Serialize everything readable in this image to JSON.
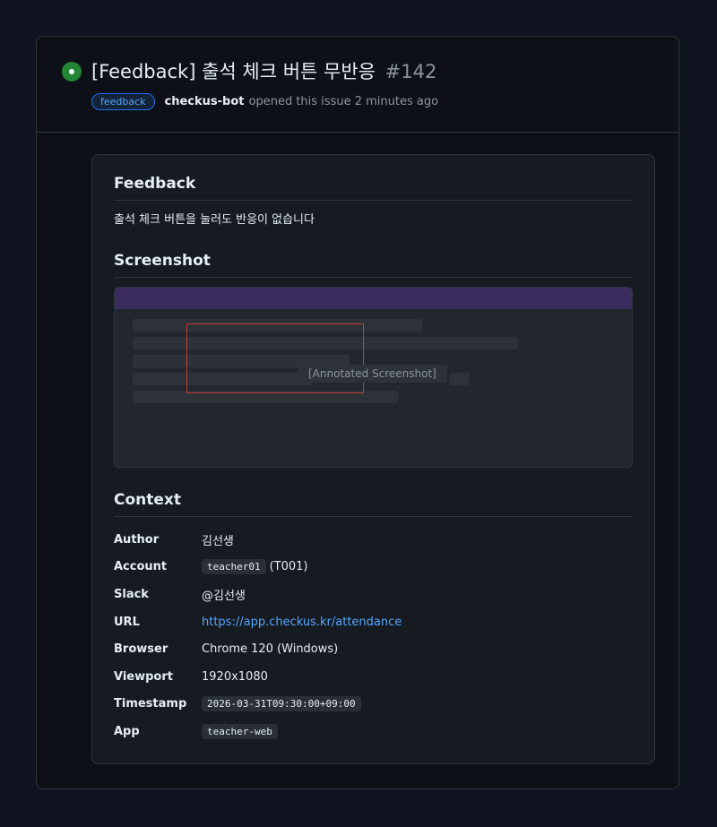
{
  "issue": {
    "title": "[Feedback] 출석 체크 버튼 무반응",
    "number": "#142",
    "label": "feedback",
    "author": "checkus-bot",
    "opened_text": "opened this issue 2 minutes ago",
    "status": "open"
  },
  "body": {
    "feedback_heading": "Feedback",
    "feedback_text": "출석 체크 버튼을 눌러도 반응이 없습니다",
    "screenshot_heading": "Screenshot",
    "screenshot_caption": "[Annotated Screenshot]",
    "context_heading": "Context",
    "context": {
      "author_label": "Author",
      "author_value": "김선생",
      "account_label": "Account",
      "account_code": "teacher01",
      "account_suffix": "(T001)",
      "slack_label": "Slack",
      "slack_value": "@김선생",
      "url_label": "URL",
      "url_value": "https://app.checkus.kr/attendance",
      "browser_label": "Browser",
      "browser_value": "Chrome 120 (Windows)",
      "viewport_label": "Viewport",
      "viewport_value": "1920x1080",
      "timestamp_label": "Timestamp",
      "timestamp_value": "2026-03-31T09:30:00+09:00",
      "app_label": "App",
      "app_value": "teacher-web"
    }
  },
  "colors": {
    "open_status": "#238636",
    "link": "#58a6ff",
    "annotation": "#c93c3c"
  },
  "icons": {
    "status": "open-issue-icon"
  }
}
